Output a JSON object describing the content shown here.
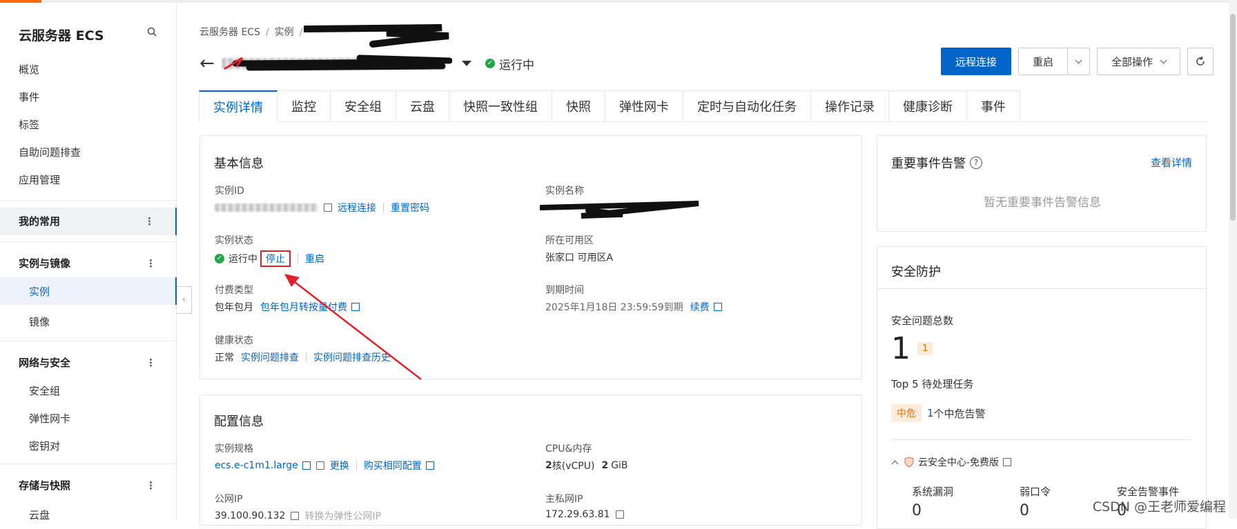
{
  "sidebar": {
    "title": "云服务器 ECS",
    "items": [
      "概览",
      "事件",
      "标签",
      "自助问题排查",
      "应用管理"
    ],
    "favorites": "我的常用",
    "groups": [
      {
        "label": "实例与镜像",
        "children": [
          "实例",
          "镜像"
        ]
      },
      {
        "label": "网络与安全",
        "children": [
          "安全组",
          "弹性网卡",
          "密钥对"
        ]
      },
      {
        "label": "存储与快照",
        "children": [
          "云盘"
        ]
      }
    ],
    "more_glyph": "⋮"
  },
  "breadcrumb": [
    "云服务器 ECS",
    "实例"
  ],
  "header": {
    "status": "运行中",
    "buttons": {
      "remote": "远程连接",
      "restart": "重启",
      "all_actions": "全部操作"
    }
  },
  "tabs": [
    "实例详情",
    "监控",
    "安全组",
    "云盘",
    "快照一致性组",
    "快照",
    "弹性网卡",
    "定时与自动化任务",
    "操作记录",
    "健康诊断",
    "事件"
  ],
  "basic": {
    "title": "基本信息",
    "instance_id_label": "实例ID",
    "remote_link": "远程连接",
    "reset_pwd": "重置密码",
    "instance_name_label": "实例名称",
    "status_label": "实例状态",
    "status_value": "运行中",
    "stop": "停止",
    "restart": "重启",
    "zone_label": "所在可用区",
    "zone_value": "张家口 可用区A",
    "billing_label": "付费类型",
    "billing_value": "包年包月",
    "billing_convert": "包年包月转按量付费",
    "expire_label": "到期时间",
    "expire_value": "2025年1月18日 23:59:59到期",
    "renew": "续费",
    "health_label": "健康状态",
    "health_value": "正常",
    "diag": "实例问题排查",
    "diag_history": "实例问题排查历史"
  },
  "config": {
    "title": "配置信息",
    "spec_label": "实例规格",
    "spec_value": "ecs.e-c1m1.large",
    "change": "更换",
    "buy_same": "购买相同配置",
    "cpu_label": "CPU&内存",
    "cpu_num": "2",
    "cpu_unit": "核(vCPU)",
    "mem_num": "2",
    "mem_unit": "GiB",
    "public_ip_label": "公网IP",
    "public_ip": "39.100.90.132",
    "convert_eip": "转换为弹性公网IP",
    "private_ip_label": "主私网IP",
    "private_ip": "172.29.63.81"
  },
  "events": {
    "title": "重要事件告警",
    "view": "查看详情",
    "empty": "暂无重要事件告警信息"
  },
  "security": {
    "title": "安全防护",
    "total_label": "安全问题总数",
    "total": "1",
    "total_badge": "1",
    "top5": "Top 5 待处理任务",
    "level": "中危",
    "alert_count": "1",
    "alert_text": "个中危告警",
    "center": "云安全中心-免费版",
    "cols": [
      {
        "label": "系统漏洞",
        "value": "0"
      },
      {
        "label": "弱口令",
        "value": "0"
      },
      {
        "label": "安全告警事件",
        "value": "0"
      }
    ]
  },
  "watermark": "CSDN @王老师爱编程",
  "colors": {
    "primary": "#0064c8",
    "ok": "#22a646",
    "annotation": "#e0202a"
  }
}
